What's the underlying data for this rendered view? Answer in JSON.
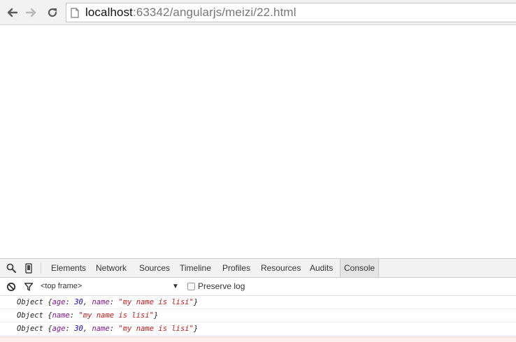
{
  "browser": {
    "url_host": "localhost",
    "url_rest": ":63342/angularjs/meizi/22.html",
    "icons": [
      "arrow-back-icon",
      "arrow-forward-icon",
      "reload-icon",
      "page-icon"
    ]
  },
  "devtools": {
    "toolbar_icons": [
      "search-icon",
      "device-mode-icon"
    ],
    "tabs": [
      "Elements",
      "Network",
      "Sources",
      "Timeline",
      "Profiles",
      "Resources",
      "Audits",
      "Console"
    ],
    "active_tab": "Console",
    "filter": {
      "frame": "<top frame>",
      "preserve_log_label": "Preserve log",
      "preserve_log_checked": false
    },
    "console_lines": [
      {
        "prefix": "Object ",
        "props": [
          {
            "k": "age",
            "v": "30",
            "t": "num"
          },
          {
            "k": "name",
            "v": "\"my name is lisi\"",
            "t": "str"
          }
        ]
      },
      {
        "prefix": "Object ",
        "props": [
          {
            "k": "name",
            "v": "\"my name is lisi\"",
            "t": "str"
          }
        ]
      },
      {
        "prefix": "Object ",
        "props": [
          {
            "k": "age",
            "v": "30",
            "t": "num"
          },
          {
            "k": "name",
            "v": "\"my name is lisi\"",
            "t": "str"
          }
        ]
      }
    ]
  }
}
